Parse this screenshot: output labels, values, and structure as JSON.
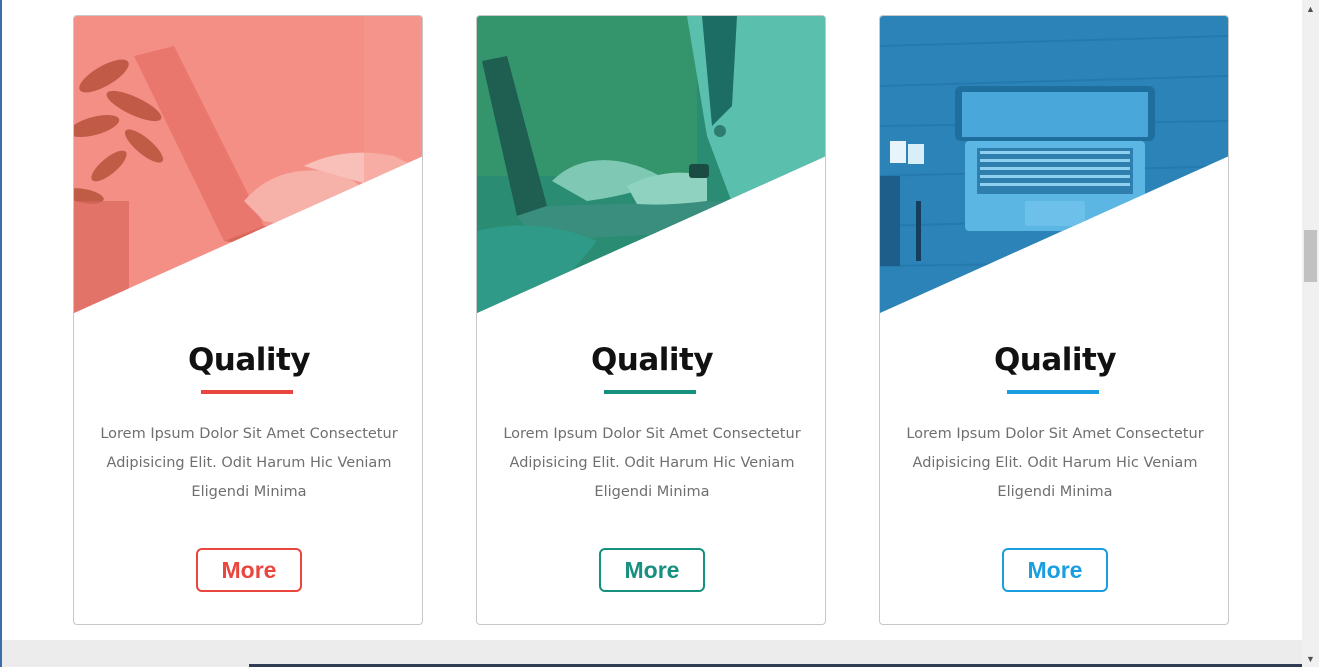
{
  "cards": [
    {
      "title": "Quality",
      "text": "Lorem Ipsum Dolor Sit Amet Consectetur Adipisicing Elit. Odit Harum Hic Veniam Eligendi Minima",
      "button_label": "More",
      "accent": "#e8463e",
      "overlay": "#f4837a",
      "image_subject": "laptop-typing-photo"
    },
    {
      "title": "Quality",
      "text": "Lorem Ipsum Dolor Sit Amet Consectetur Adipisicing Elit. Odit Harum Hic Veniam Eligendi Minima",
      "button_label": "More",
      "accent": "#16907f",
      "overlay": "#1a8f78",
      "image_subject": "laptop-on-lap-photo"
    },
    {
      "title": "Quality",
      "text": "Lorem Ipsum Dolor Sit Amet Consectetur Adipisicing Elit. Odit Harum Hic Veniam Eligendi Minima",
      "button_label": "More",
      "accent": "#1b9ee0",
      "overlay": "#2a8cc4",
      "image_subject": "laptop-on-desk-photo"
    }
  ],
  "scrollbar": {
    "up_icon": "scroll-up-arrow-icon",
    "down_icon": "scroll-down-arrow-icon"
  }
}
